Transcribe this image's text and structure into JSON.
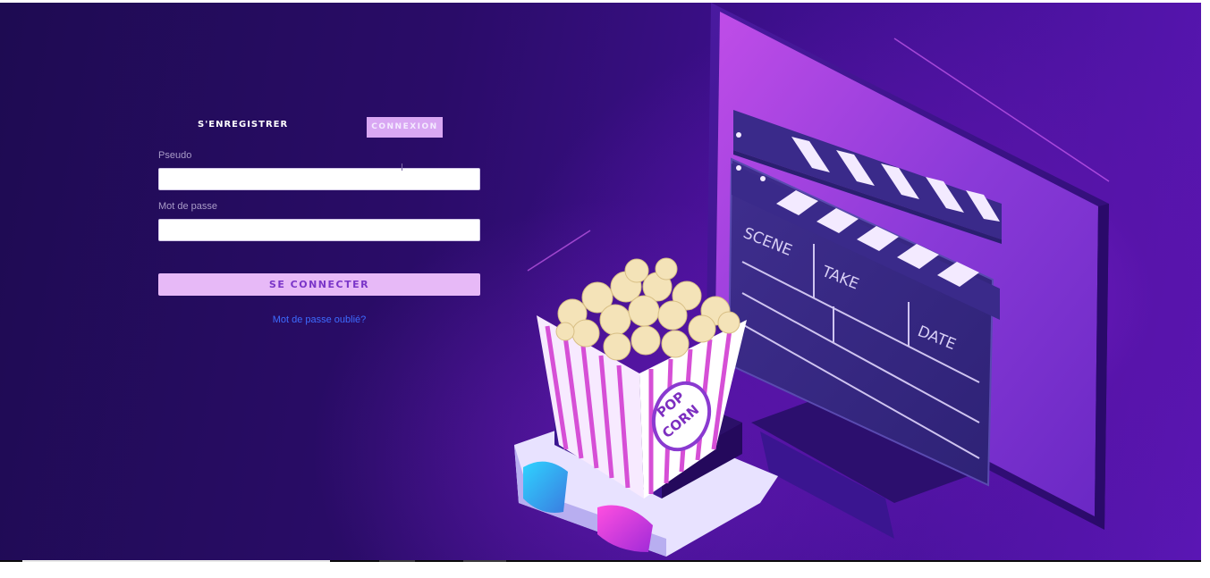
{
  "auth": {
    "tabs": {
      "register_label": "S'ENREGISTRER",
      "login_label": "CONNEXION",
      "active": "login"
    },
    "username": {
      "label": "Pseudo",
      "value": ""
    },
    "password": {
      "label": "Mot de passe",
      "value": ""
    },
    "submit_label": "SE CONNECTER",
    "forgot_link": "Mot de passe oublié?"
  },
  "illustration": {
    "popcorn_text_1": "POP",
    "popcorn_text_2": "CORN",
    "clapper_scene": "SCENE",
    "clapper_take": "TAKE",
    "clapper_date": "DATE"
  },
  "colors": {
    "background": "#2a0c68",
    "active_tab": "#d9a7f3",
    "button": "#e7b9f7",
    "button_text": "#7a35c8",
    "link": "#3d6bff",
    "label": "#a99cc8"
  },
  "icons": [
    "popcorn-box-icon",
    "clapperboard-icon",
    "monitor-icon",
    "3d-glasses-icon"
  ]
}
